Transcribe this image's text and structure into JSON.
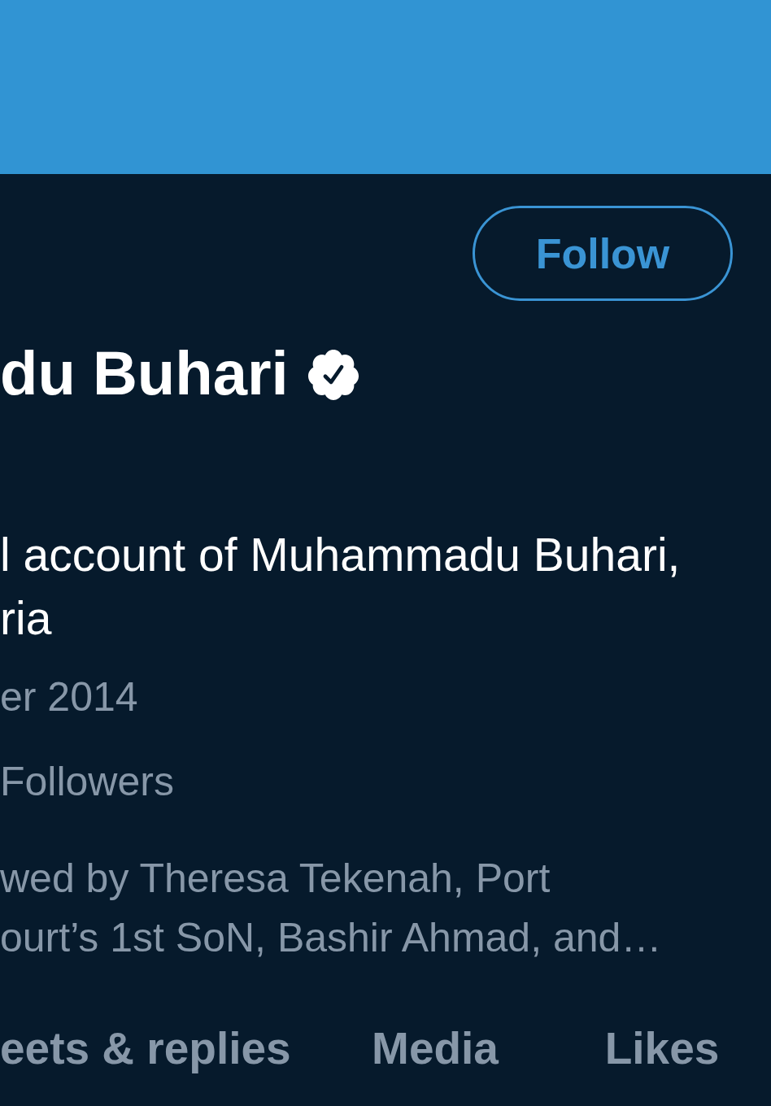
{
  "follow_button": {
    "label": "Follow"
  },
  "profile": {
    "name": "du Buhari",
    "verified": true,
    "bio_lines": [
      "l account of Muhammadu Buhari,",
      "ria"
    ],
    "joined": "er 2014",
    "followers": "Followers",
    "followed_by_lines": [
      "wed by Theresa Tekenah, Port",
      "ourt’s 1st SoN, Bashir Ahmad, and…"
    ]
  },
  "tabs": [
    {
      "label": "eets & replies",
      "selected": false
    },
    {
      "label": "Media",
      "selected": false
    },
    {
      "label": "Likes",
      "selected": false
    }
  ]
}
